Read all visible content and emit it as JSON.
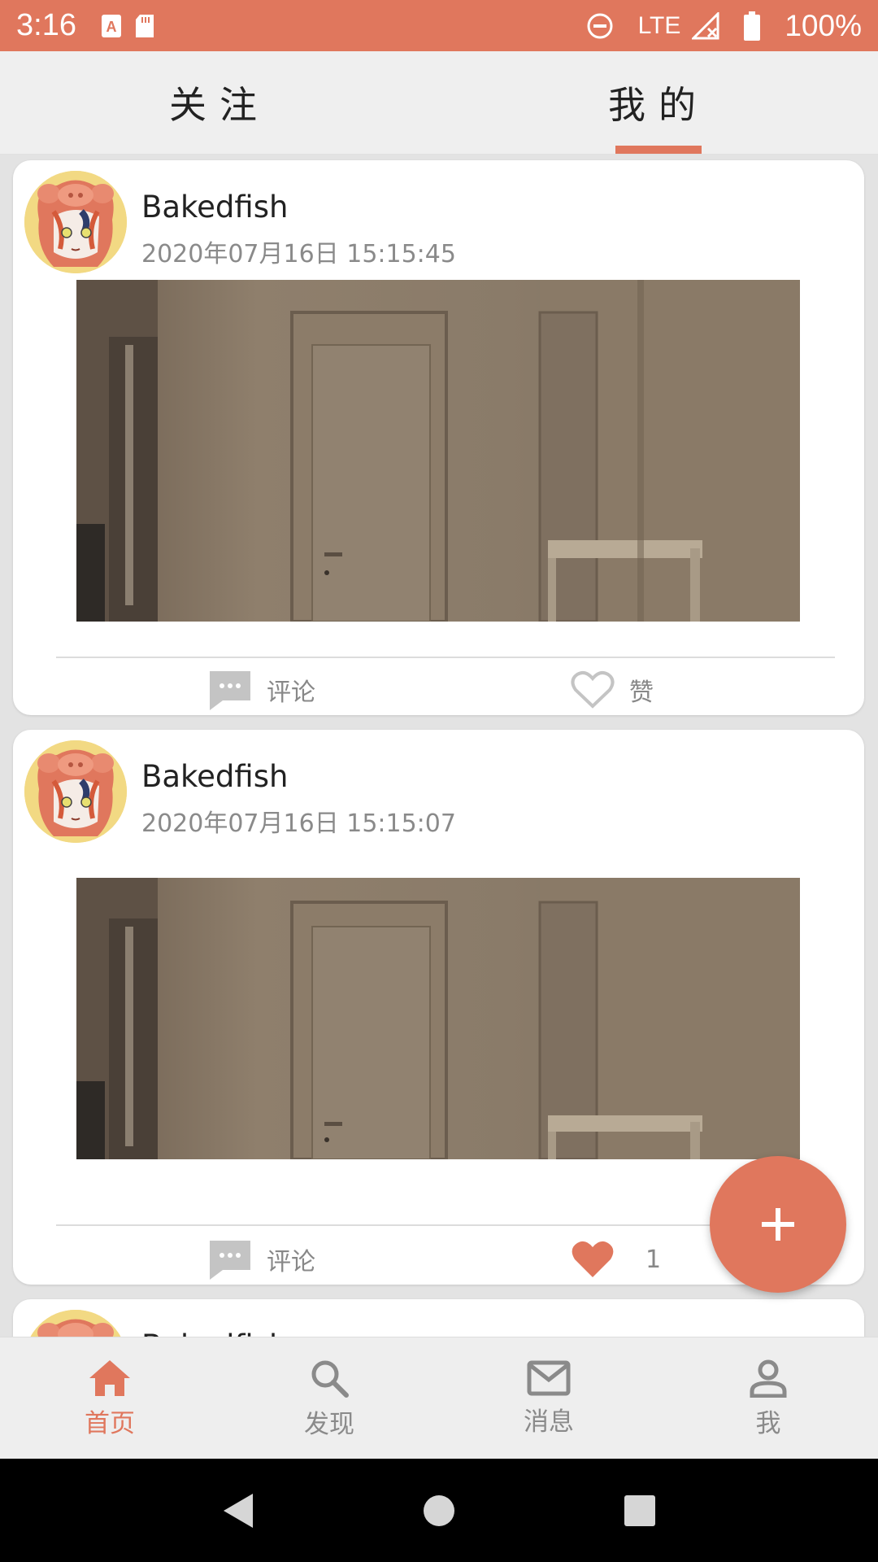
{
  "status_bar": {
    "time": "3:16",
    "network": "LTE",
    "battery": "100%"
  },
  "top_tabs": [
    {
      "label": "关注",
      "active": false
    },
    {
      "label": "我的",
      "active": true
    }
  ],
  "posts": [
    {
      "username": "Bakedfish",
      "timestamp": "2020年07月16日 15:15:45",
      "comment_label": "评论",
      "like_label": "赞",
      "liked": false
    },
    {
      "username": "Bakedfish",
      "timestamp": "2020年07月16日 15:15:07",
      "comment_label": "评论",
      "like_label": "1",
      "liked": true
    },
    {
      "username": "Bakedfish"
    }
  ],
  "fab": {
    "icon": "plus-icon"
  },
  "bottom_nav": [
    {
      "label": "首页",
      "icon": "home-icon",
      "active": true
    },
    {
      "label": "发现",
      "icon": "search-icon",
      "active": false
    },
    {
      "label": "消息",
      "icon": "mail-icon",
      "active": false
    },
    {
      "label": "我",
      "icon": "person-icon",
      "active": false
    }
  ],
  "colors": {
    "accent": "#e0775d",
    "background": "#e3e3e3",
    "card": "#ffffff",
    "muted_text": "#8a8a8a"
  }
}
